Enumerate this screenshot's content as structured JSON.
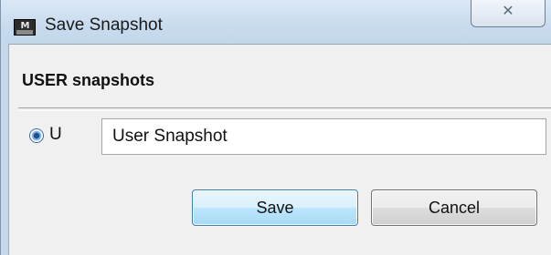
{
  "window": {
    "title": "Save Snapshot",
    "icon": "app-logo-icon",
    "close_symbol": "✕"
  },
  "group": {
    "header": "USER snapshots"
  },
  "snapshot": {
    "radio_label": "U",
    "radio_selected": true,
    "name_value": "User Snapshot"
  },
  "buttons": {
    "save_label": "Save",
    "cancel_label": "Cancel"
  },
  "colors": {
    "title_bar": "#c8dbee",
    "client_bg": "#f0f0f0",
    "default_button_border": "#3c7fb1"
  }
}
